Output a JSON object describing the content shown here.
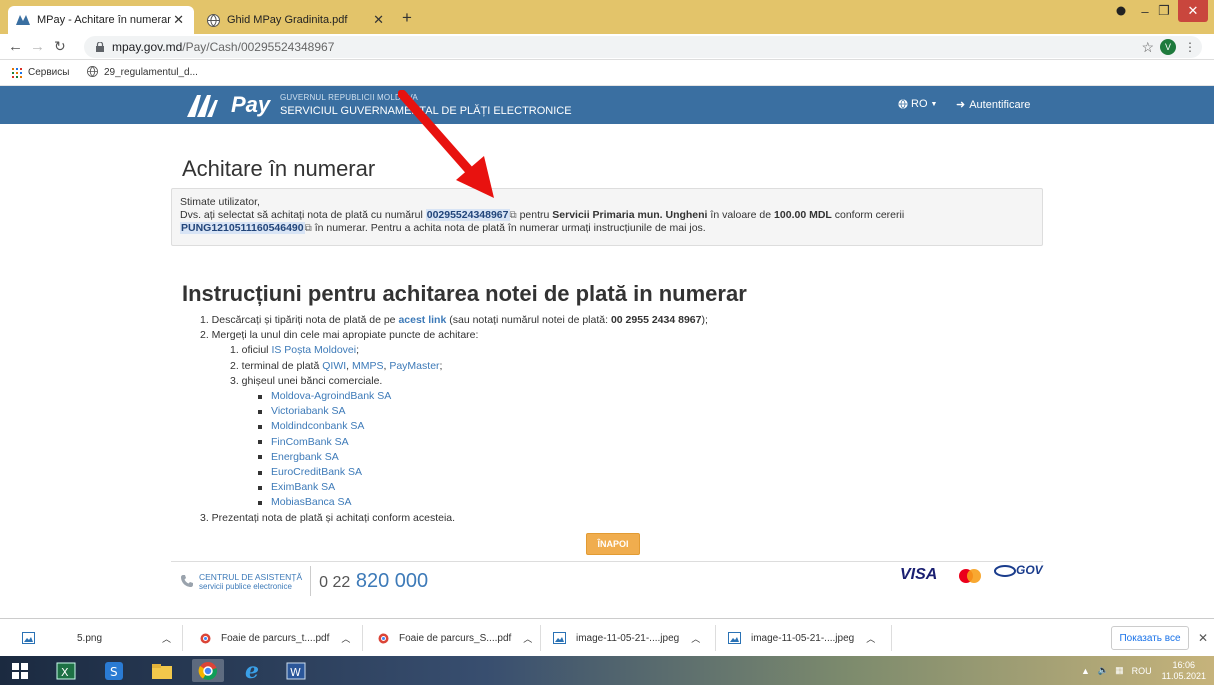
{
  "browser": {
    "tabs": [
      {
        "title": "MPay - Achitare în numerar",
        "active": true
      },
      {
        "title": "Ghid MPay Gradinita.pdf",
        "active": false
      }
    ],
    "new_tab": "+",
    "url_host": "mpay.gov.md",
    "url_path": "/Pay/Cash/00295524348967",
    "profile_initial": "V",
    "bookmarks": [
      {
        "label": "Сервисы"
      },
      {
        "label": "29_regulamentul_d..."
      }
    ]
  },
  "site": {
    "logo": "M Pay",
    "gov_line1": "GUVERNUL REPUBLICII MOLDOVA",
    "gov_line2": "SERVICIUL GUVERNAMENTAL DE PLĂȚI ELECTRONICE",
    "lang": "RO",
    "login": "Autentificare"
  },
  "page": {
    "title": "Achitare în numerar",
    "greeting": "Stimate utilizator,",
    "msg_part1": "Dvs. ați selectat să achitați nota de plată cu numărul",
    "invoice_no": "00295524348967",
    "msg_part2": "pentru",
    "service": "Servicii Primaria mun. Ungheni",
    "msg_part3": "în valoare de",
    "amount": "100.00 MDL",
    "msg_part4": "conform cererii",
    "request_no": "PUNG1210511160546490",
    "msg_part5": "în numerar. Pentru a achita nota de plată în numerar urmați instrucțiunile de mai jos.",
    "instr_title": "Instrucțiuni pentru achitarea notei de plată in numerar",
    "step1_a": "1. Descărcați și tipăriți nota de plată de pe",
    "step1_link": "acest link",
    "step1_b": "(sau notați numărul notei de plată:",
    "step1_num": "00 2955 2434 8967",
    "step1_c": ");",
    "step2": "2. Mergeți la unul din cele mai apropiate puncte de achitare:",
    "sub1_a": "1. oficiul",
    "sub1_link": "IS Poșta Moldovei",
    "sub1_b": ";",
    "sub2_a": "2. terminal de plată",
    "sub2_l1": "QIWI",
    "sub2_l2": "MMPS",
    "sub2_l3": "PayMaster",
    "sub2_sep": ",",
    "sub2_b": ";",
    "sub3": "3. ghișeul unei bănci comerciale.",
    "banks": [
      "Moldova-AgroindBank SA",
      "Victoriabank SA",
      "Moldindconbank SA",
      "FinComBank SA",
      "Energbank SA",
      "EuroCreditBank SA",
      "EximBank SA",
      "MobiasBanca SA"
    ],
    "step3": "3. Prezentați nota de plată și achitați conform acesteia.",
    "back": "ÎNAPOI"
  },
  "footer": {
    "support1": "CENTRUL DE ASISTENȚĂ",
    "support2": "servicii publice electronice",
    "phone_pre": "0 22",
    "phone": "820 000",
    "visa": "VISA",
    "gov": "GOV"
  },
  "downloads": {
    "items": [
      "5.png",
      "Foaie de parcurs_t....pdf",
      "Foaie de parcurs_S....pdf",
      "image-11-05-21-....jpeg",
      "image-11-05-21-....jpeg"
    ],
    "show_all": "Показать все"
  },
  "taskbar": {
    "lang": "ROU",
    "time": "16:06",
    "date": "11.05.2021"
  },
  "colors": {
    "header": "#3a6fa1",
    "link": "#3d7ab8",
    "button": "#f0ad4e",
    "tabbar": "#e3c46a"
  }
}
